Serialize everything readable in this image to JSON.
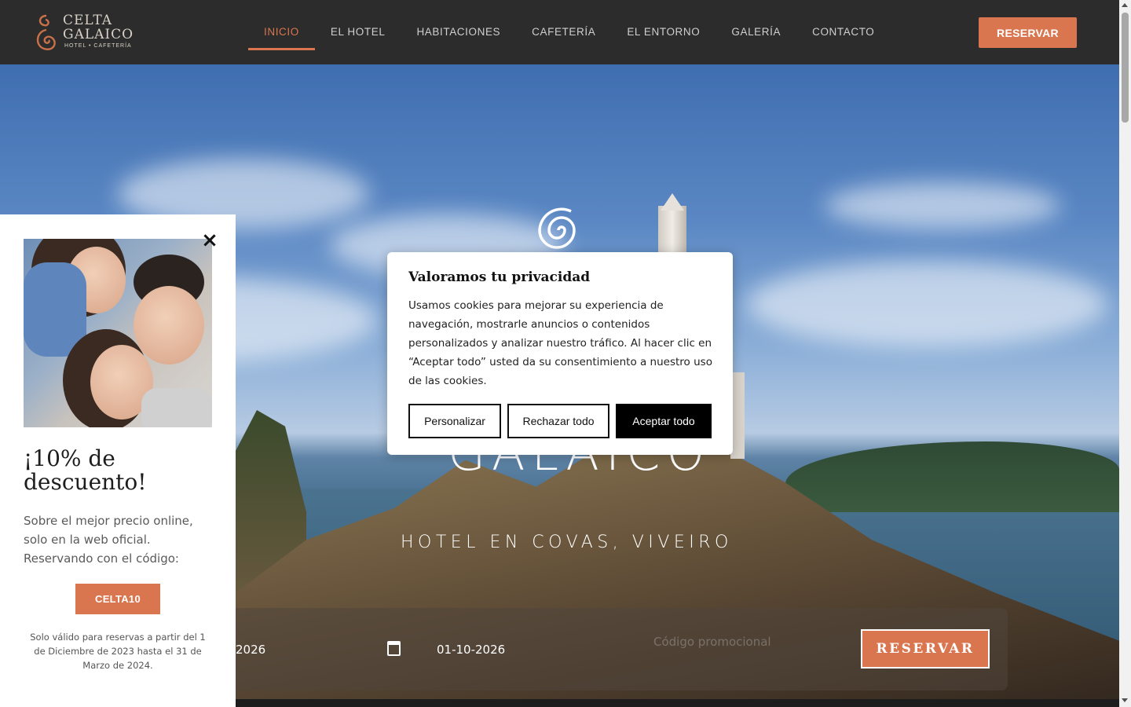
{
  "brand": {
    "logo_line1": "CELTA",
    "logo_line2": "GALAICO",
    "logo_line3": "HOTEL • CAFETERÍA"
  },
  "nav": {
    "items": [
      {
        "label": "INICIO",
        "active": true
      },
      {
        "label": "EL HOTEL"
      },
      {
        "label": "HABITACIONES"
      },
      {
        "label": "CAFETERÍA"
      },
      {
        "label": "EL ENTORNO"
      },
      {
        "label": "GALERÍA"
      },
      {
        "label": "CONTACTO"
      }
    ],
    "reserve_button": "RESERVAR"
  },
  "hero": {
    "title": "GALAICO",
    "subtitle": "HOTEL EN COVAS, VIVEIRO"
  },
  "booking": {
    "checkin": "2026",
    "checkout": "01-10-2026",
    "promo_placeholder": "Código promocional",
    "button": "RESERVAR"
  },
  "promo": {
    "close": "×",
    "title": "¡10% de descuento!",
    "text": "Sobre el mejor precio online, solo en la web oficial. Reservando con el código:",
    "code": "CELTA10",
    "note": "Solo válido para reservas a partir del 1 de Diciembre de 2023 hasta el 31 de Marzo de 2024."
  },
  "cookie": {
    "title": "Valoramos tu privacidad",
    "text": "Usamos cookies para mejorar su experiencia de navegación, mostrarle anuncios o contenidos personalizados y analizar nuestro tráfico. Al hacer clic en “Aceptar todo” usted da su consentimiento a nuestro uso de las cookies.",
    "customize": "Personalizar",
    "reject": "Rechazar todo",
    "accept": "Aceptar todo"
  },
  "colors": {
    "accent": "#d9764f",
    "header_bg": "#2c2c2c"
  }
}
